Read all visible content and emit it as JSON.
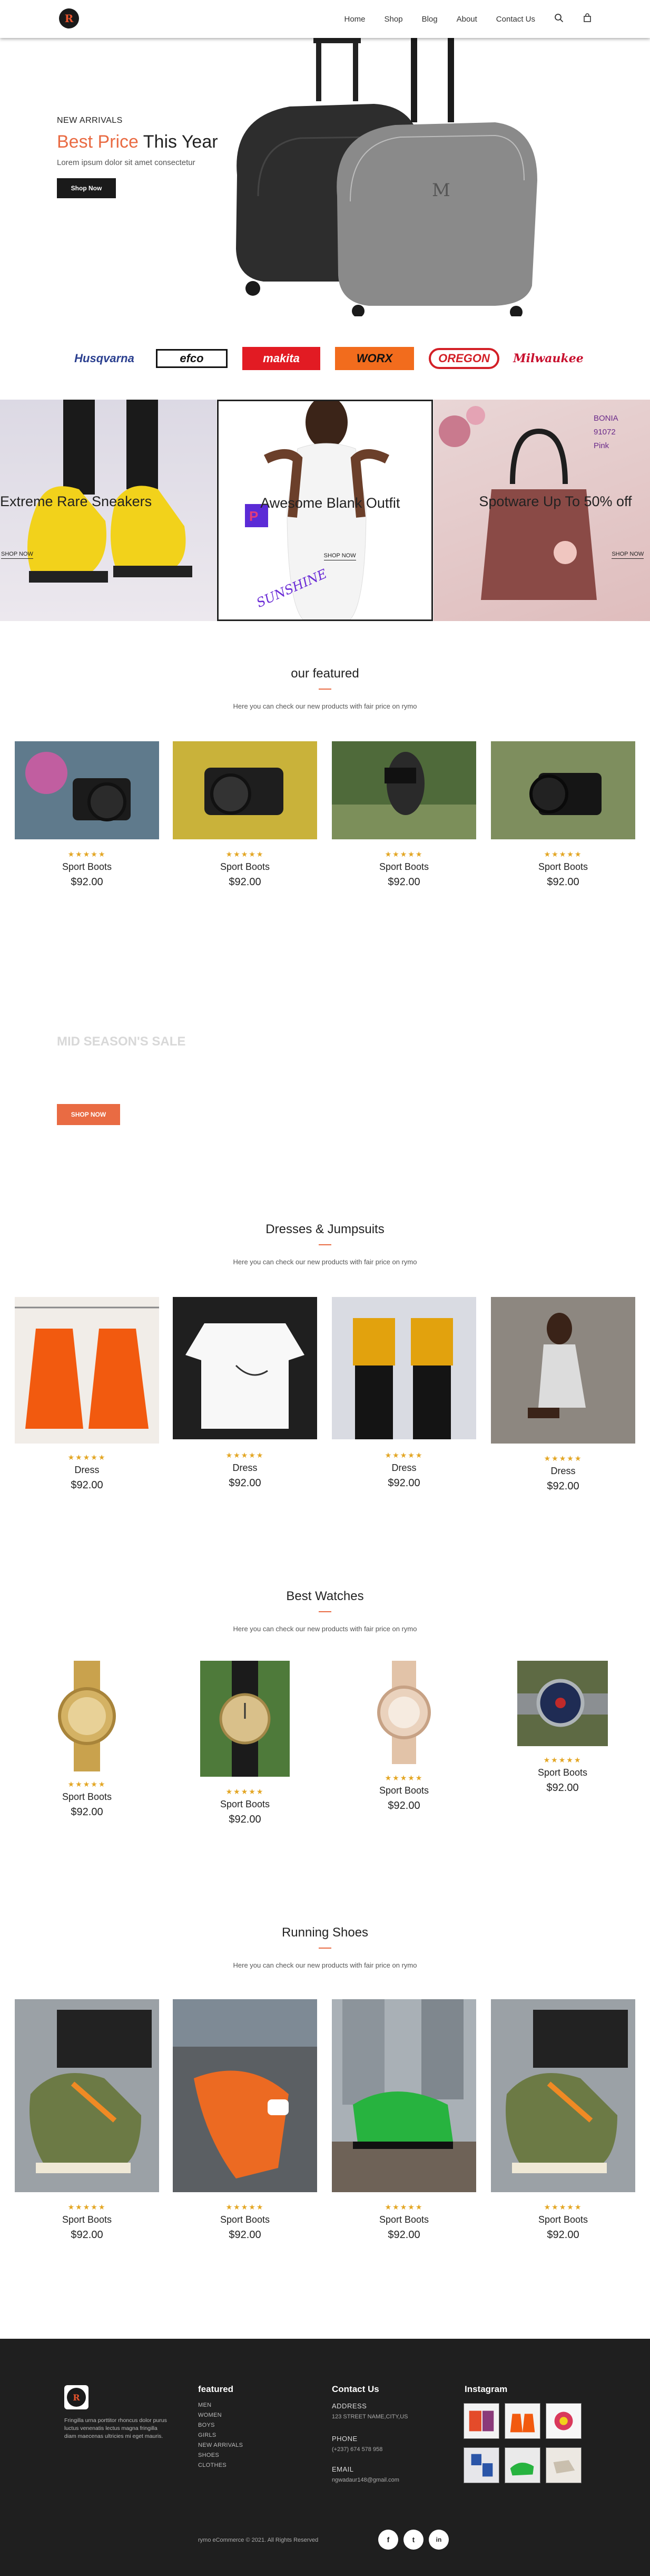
{
  "header": {
    "logo_text": "R",
    "nav": [
      "Home",
      "Shop",
      "Blog",
      "About",
      "Contact Us"
    ],
    "search_icon": "search-icon",
    "bag_icon": "shopping-bag-icon"
  },
  "hero": {
    "subtitle": "NEW ARRIVALS",
    "title_accent": "Best Price",
    "title_rest": " This Year",
    "description": "Lorem ipsum dolor sit amet consectetur",
    "button": "Shop Now"
  },
  "brands": [
    "Husqvarna",
    "efco",
    "makita",
    "WORX",
    "OREGON",
    "Milwaukee"
  ],
  "promos": [
    {
      "title": "Extreme Rare Sneakers",
      "cta": "SHOP NOW"
    },
    {
      "title": "Awesome Blank Outfit",
      "cta": "SHOP NOW",
      "overlay_text": "SUNSHINE"
    },
    {
      "title": "Spotware Up To 50% off",
      "cta": "SHOP NOW",
      "sign_lines": [
        "BONIA",
        "91072",
        "Pink"
      ]
    }
  ],
  "featured": {
    "title": "our featured",
    "subtitle": "Here you can check our new products with fair price on rymo",
    "items": [
      {
        "name": "Sport Boots",
        "price": "$92.00",
        "stars": "★★★★★"
      },
      {
        "name": "Sport Boots",
        "price": "$92.00",
        "stars": "★★★★★"
      },
      {
        "name": "Sport Boots",
        "price": "$92.00",
        "stars": "★★★★★"
      },
      {
        "name": "Sport Boots",
        "price": "$92.00",
        "stars": "★★★★★"
      }
    ]
  },
  "mid_season": {
    "title": "MID SEASON'S SALE",
    "button": "SHOP NOW"
  },
  "dresses": {
    "title": "Dresses & Jumpsuits",
    "subtitle": "Here you can check our new products with fair price on rymo",
    "items": [
      {
        "name": "Dress",
        "price": "$92.00",
        "stars": "★★★★★"
      },
      {
        "name": "Dress",
        "price": "$92.00",
        "stars": "★★★★★"
      },
      {
        "name": "Dress",
        "price": "$92.00",
        "stars": "★★★★★"
      },
      {
        "name": "Dress",
        "price": "$92.00",
        "stars": "★★★★★"
      }
    ]
  },
  "watches": {
    "title": "Best Watches",
    "subtitle": "Here you can check our new products with fair price on rymo",
    "items": [
      {
        "name": "Sport Boots",
        "price": "$92.00",
        "stars": "★★★★★"
      },
      {
        "name": "Sport Boots",
        "price": "$92.00",
        "stars": "★★★★★"
      },
      {
        "name": "Sport Boots",
        "price": "$92.00",
        "stars": "★★★★★"
      },
      {
        "name": "Sport Boots",
        "price": "$92.00",
        "stars": "★★★★★"
      }
    ]
  },
  "shoes": {
    "title": "Running Shoes",
    "subtitle": "Here you can check our new products with fair price on rymo",
    "items": [
      {
        "name": "Sport Boots",
        "price": "$92.00",
        "stars": "★★★★★"
      },
      {
        "name": "Sport Boots",
        "price": "$92.00",
        "stars": "★★★★★"
      },
      {
        "name": "Sport Boots",
        "price": "$92.00",
        "stars": "★★★★★"
      },
      {
        "name": "Sport Boots",
        "price": "$92.00",
        "stars": "★★★★★"
      }
    ]
  },
  "footer": {
    "about": "Fringilla urna porttitor rhoncus dolor purus luctus venenatis lectus magna fringilla diam maecenas ultricies mi eget mauris.",
    "featured_title": "featured",
    "featured_links": [
      "MEN",
      "WOMEN",
      "BOYS",
      "GIRLS",
      "NEW ARRIVALS",
      "SHOES",
      "CLOTHES"
    ],
    "contact_title": "Contact Us",
    "address_label": "ADDRESS",
    "address_value": "123 STREET NAME,CITY,US",
    "phone_label": "PHONE",
    "phone_value": "(+237) 674 578 958",
    "email_label": "EMAIL",
    "email_value": "ngwadaur148@gmail.com",
    "instagram_title": "Instagram",
    "copyright": "rymo eCommerce © 2021. All Rights Reserved",
    "social": [
      "f",
      "t",
      "in"
    ]
  },
  "colors": {
    "accent": "#e96b43",
    "stars": "#e3a624",
    "footer_bg": "#1f1f1f",
    "dark_button": "#1a1a1a"
  }
}
